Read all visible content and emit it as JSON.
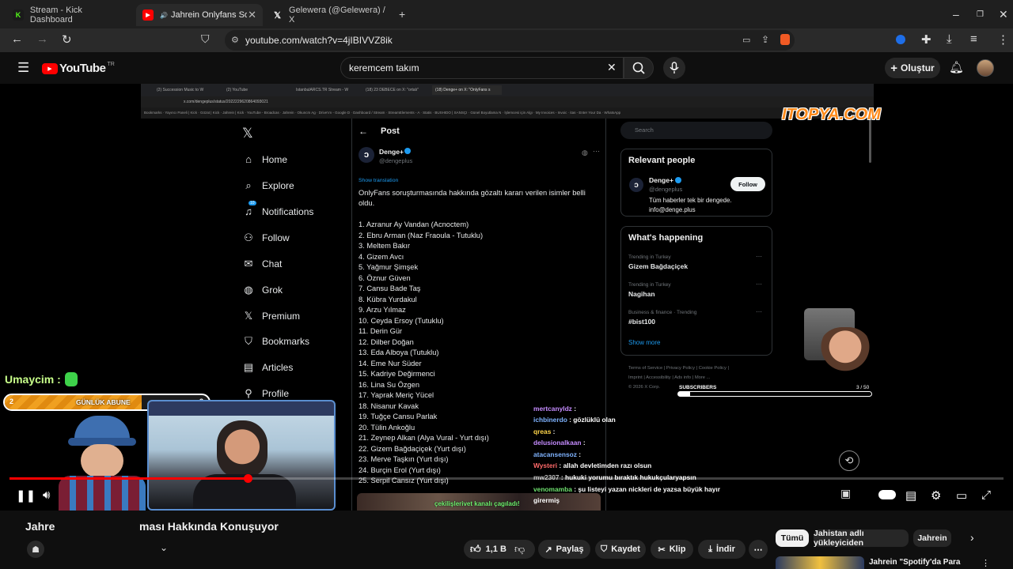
{
  "browser": {
    "tabs": [
      {
        "title": "Stream - Kick Dashboard",
        "favicon": "kick-icon",
        "active": false
      },
      {
        "title": "Jahrein Onlyfans Soruşturm",
        "favicon": "youtube-icon",
        "active": true
      },
      {
        "title": "Gelewera (@Gelewera) / X",
        "favicon": "x-icon",
        "active": false
      }
    ],
    "new_tab": "+",
    "url": "youtube.com/watch?v=4jIBIVVZ8ik"
  },
  "youtube": {
    "logo_text": "YouTube",
    "region": "TR",
    "search_value": "keremcem takım",
    "create_label": "Oluştur",
    "video_title": "Jahrein Onlyfans Soruşturması Hakkında Konuşuyor",
    "video_title_visible_left": "Jahre",
    "video_title_visible_right": "ması Hakkında Konuşuyor",
    "actions": {
      "likes": "1,1 B",
      "share": "Paylaş",
      "save": "Kaydet",
      "clip": "Klip",
      "download": "İndir"
    },
    "chips": [
      "Tümü",
      "Jahistan adlı yükleyiciden",
      "Jahrein"
    ],
    "recommended_title": "Jahrein \"Spotify'da Para",
    "progress": 0.24
  },
  "stream": {
    "watermark": "ITOPYA.COM",
    "overlay_user": "Umaycim :",
    "subgoal": {
      "current": "2",
      "label": "GÜNLÜK ABUNE",
      "target": "3",
      "fill": 0.67
    },
    "subscribers_label": "SUBSCRIBERS",
    "subscribers_count": "3 / 50",
    "chat": [
      {
        "user": "mertcanyldz",
        "text": "",
        "color": "#c58cff"
      },
      {
        "user": "ichbinerdo",
        "text": "gözlüklü olan",
        "color": "#7fb3ff"
      },
      {
        "user": "qreas",
        "text": "",
        "color": "#ffd54a"
      },
      {
        "user": "delusionalkaan",
        "text": "",
        "color": "#c58cff"
      },
      {
        "user": "atacansensoz",
        "text": "",
        "color": "#7fb3ff"
      },
      {
        "user": "Wysteri",
        "text": "allah devletimden razı olsun",
        "color": "#ff6a6a"
      },
      {
        "user": "mw2307",
        "text": "hukuki yorumu bıraktık hukukçularyapsın",
        "color": "#bbbbbb"
      },
      {
        "user": "venomamba",
        "text": "şu listeyi yazan nickleri de yazsa büyük hayır",
        "color": "#6ee06e"
      },
      {
        "user": "",
        "text": "girermiş",
        "color": "#ffffff"
      }
    ]
  },
  "xpage": {
    "inner_tabs": [
      "(2) Succession Music to W",
      "(2) YouTube",
      "IstanbulARCS.TR Stream - W",
      "(18) 23 DEBECE on X: \"ortalı\"",
      "(18) Denge+ on X: \"OnlyFans s"
    ],
    "inner_url": "x.com/dengeplus/status/2022229620864093021",
    "bookmarks": "Bookmarks · Yayıncı Paneli | Kick · Gözat | Kick · Jahrein | Kick · YouTube - Broadcas · Jahrein · Okuncm Ag · Drive'ım - Google D · Dashboard / Stream · StreamElements - A · Statis · BUSHIDO | SANSÇI · Günel Boyutlama N · İşlemcesi için Algı · My Invoices - Invoic · itas - Enter Your Da · WhatsApp",
    "nav": [
      "Home",
      "Explore",
      "Notifications",
      "Follow",
      "Chat",
      "Grok",
      "Premium",
      "Bookmarks",
      "Articles",
      "Profile"
    ],
    "notif_badge": "10",
    "post_header": "Post",
    "author_name": "Denge+",
    "author_handle": "@dengeplus",
    "show_translation": "Show translation",
    "intro": [
      "OnlyFans soruşturmasında hakkında gözaltı kararı verilen isimler belli",
      "oldu."
    ],
    "names": [
      "1. Azranur Ay Vandan (Acnoctem)",
      "2. Ebru Arman (Naz Fraoula - Tutuklu)",
      "3. Meltem Bakır",
      "4. Gizem Avcı",
      "5. Yağmur Şimşek",
      "6. Öznur Güven",
      "7. Cansu Bade Taş",
      "8. Kübra Yurdakul",
      "9. Arzu Yılmaz",
      "10. Ceyda Ersoy (Tutuklu)",
      "11. Derin Gür",
      "12. Dilber Doğan",
      "13. Eda Alboya (Tutuklu)",
      "14. Eme Nur Süder",
      "15. Kadriye Değirmenci",
      "16. Lina Su Özgen",
      "17. Yaprak Meriç Yücel",
      "18. Nisanur Kavak",
      "19. Tuğçe Cansu Parlak",
      "20. Tülin Ankoğlu",
      "21. Zeynep Alkan (Alya Vural - Yurt dışı)",
      "22. Gizem Bağdaçiçek (Yurt dışı)",
      "23. Merve Taşkın (Yurt dışı)",
      "24. Burçin Erol (Yurt dışı)",
      "25. Serpil Cansız (Yurt dışı)"
    ],
    "media_caption": "çekilişlerivet kanalı çagıladı!",
    "search_placeholder": "Search",
    "relevant_title": "Relevant people",
    "relevant_name": "Denge+",
    "relevant_handle": "@dengeplus",
    "relevant_follow": "Follow",
    "relevant_bio": [
      "Tüm haberler tek bir dengede.",
      "info@denge.plus"
    ],
    "happening_title": "What's happening",
    "trends": [
      {
        "meta": "Trending in Turkey",
        "name": "Gizem Bağdaçiçek"
      },
      {
        "meta": "Trending in Turkey",
        "name": "Nagihan"
      },
      {
        "meta": "Business & finance · Trending",
        "name": "#bist100"
      }
    ],
    "show_more": "Show more",
    "footer": [
      "Terms of Service",
      "Privacy Policy",
      "Cookie Policy",
      "Imprint",
      "Accessibility",
      "Ads info",
      "More ...",
      "© 2026 X Corp."
    ]
  }
}
